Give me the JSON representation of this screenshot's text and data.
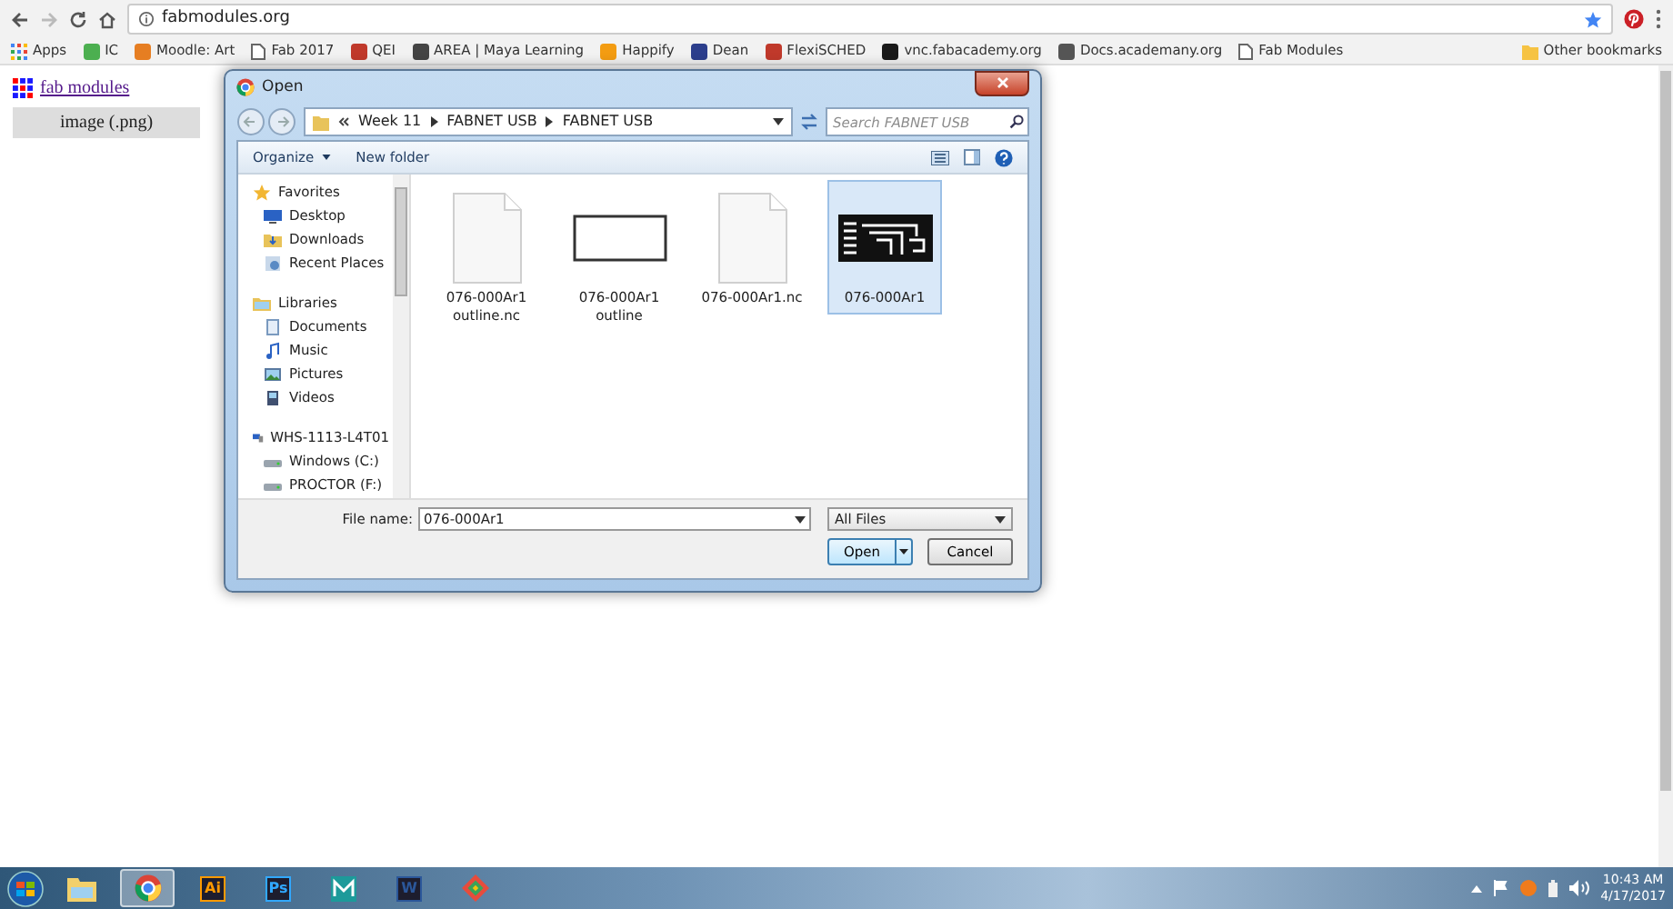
{
  "browser": {
    "address": "fabmodules.org",
    "bookmarked": true,
    "bookmarks": [
      {
        "kind": "apps",
        "label": "Apps"
      },
      {
        "kind": "site",
        "label": "IC",
        "color": "#4caf50"
      },
      {
        "kind": "site",
        "label": "Moodle: Art",
        "color": "#e67e22"
      },
      {
        "kind": "page",
        "label": "Fab 2017"
      },
      {
        "kind": "site",
        "label": "QEI",
        "color": "#c0392b"
      },
      {
        "kind": "site",
        "label": "AREA | Maya Learning",
        "color": "#444444"
      },
      {
        "kind": "site",
        "label": "Happify",
        "color": "#f39c12"
      },
      {
        "kind": "site",
        "label": "Dean",
        "color": "#2c3e8c"
      },
      {
        "kind": "site",
        "label": "FlexiSCHED",
        "color": "#c0392b"
      },
      {
        "kind": "site",
        "label": "vnc.fabacademy.org",
        "color": "#1a1a1a"
      },
      {
        "kind": "site",
        "label": "Docs.academany.org",
        "color": "#555555"
      },
      {
        "kind": "page",
        "label": "Fab Modules"
      }
    ],
    "other_bookmarks": "Other bookmarks"
  },
  "page": {
    "title_link": "fab modules",
    "menu_item": "image (.png)"
  },
  "dialog": {
    "title": "Open",
    "breadcrumb": [
      "Week 11",
      "FABNET USB",
      "FABNET USB"
    ],
    "search": {
      "placeholder": "Search FABNET USB"
    },
    "toolbar": [
      "Organize",
      "New folder"
    ],
    "nav": [
      {
        "label": "Favorites",
        "kind": "favorites",
        "children": [
          {
            "label": "Desktop",
            "kind": "desktop"
          },
          {
            "label": "Downloads",
            "kind": "downloads"
          },
          {
            "label": "Recent Places",
            "kind": "recent"
          }
        ]
      },
      {
        "label": "Libraries",
        "kind": "libraries",
        "children": [
          {
            "label": "Documents",
            "kind": "documents"
          },
          {
            "label": "Music",
            "kind": "music"
          },
          {
            "label": "Pictures",
            "kind": "pictures"
          },
          {
            "label": "Videos",
            "kind": "videos"
          }
        ]
      },
      {
        "label": "WHS-1113-L4T01",
        "kind": "computer",
        "children": [
          {
            "label": "Windows (C:)",
            "kind": "drive"
          },
          {
            "label": "PROCTOR (F:)",
            "kind": "drive"
          }
        ]
      }
    ],
    "files": [
      {
        "name": "076-000Ar1 outline.nc",
        "kind": "document",
        "selected": false
      },
      {
        "name": "076-000Ar1 outline",
        "kind": "outline-image",
        "selected": false
      },
      {
        "name": "076-000Ar1.nc",
        "kind": "document",
        "selected": false
      },
      {
        "name": "076-000Ar1",
        "kind": "board-image",
        "selected": true
      }
    ],
    "file_name_label": "File name:",
    "file_name": "076-000Ar1",
    "filter": "All Files",
    "buttons": [
      {
        "label": "Open",
        "kind": "split"
      },
      {
        "label": "Cancel",
        "kind": "plain"
      }
    ]
  },
  "taskbar": {
    "apps": [
      {
        "kind": "explorer",
        "selected": false
      },
      {
        "kind": "chrome",
        "selected": true
      },
      {
        "kind": "letter",
        "label": "Ai",
        "color": "#ff9a00"
      },
      {
        "kind": "letter",
        "label": "Ps",
        "color": "#31a8ff"
      },
      {
        "kind": "maya",
        "selected": false
      },
      {
        "kind": "letter",
        "label": "W",
        "color": "#2b579a"
      },
      {
        "kind": "diamond",
        "selected": false
      }
    ],
    "time": "10:43 AM",
    "date": "4/17/2017"
  }
}
